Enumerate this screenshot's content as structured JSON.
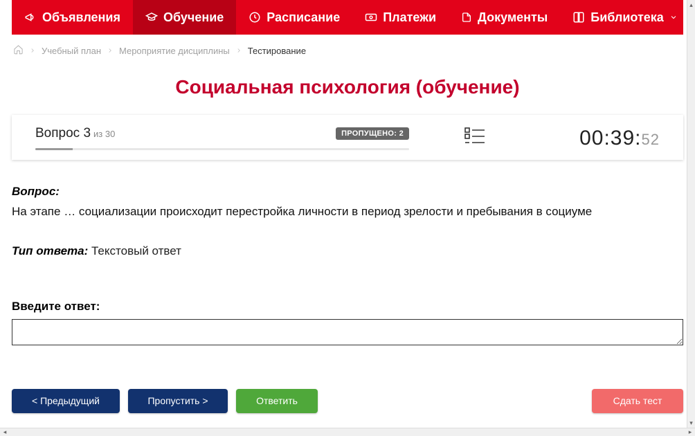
{
  "nav": {
    "items": [
      {
        "label": "Объявления",
        "icon": "megaphone-icon",
        "active": false
      },
      {
        "label": "Обучение",
        "icon": "grad-cap-icon",
        "active": true
      },
      {
        "label": "Расписание",
        "icon": "clock-icon",
        "active": false
      },
      {
        "label": "Платежи",
        "icon": "payment-icon",
        "active": false
      },
      {
        "label": "Документы",
        "icon": "document-icon",
        "active": false
      },
      {
        "label": "Библиотека",
        "icon": "book-icon",
        "active": false,
        "chevron": true
      }
    ]
  },
  "breadcrumb": {
    "items": [
      {
        "label": "Учебный план"
      },
      {
        "label": "Мероприятие дисциплины"
      },
      {
        "label": "Тестирование",
        "current": true
      }
    ]
  },
  "title": "Социальная психология (обучение)",
  "status": {
    "question_word": "Вопрос",
    "question_number": "3",
    "of_word": "из",
    "total": "30",
    "skipped_label": "ПРОПУЩЕНО:",
    "skipped_count": "2",
    "progress_percent": 10,
    "timer_mmss": "00:39:",
    "timer_secs": "52"
  },
  "question": {
    "q_label": "Вопрос:",
    "q_text": "На этапе … социализации происходит перестройка личности в период зрелости и пребывания в социуме",
    "type_label": "Тип ответа:",
    "type_value": "Текстовый ответ",
    "answer_label": "Введите ответ:",
    "answer_value": ""
  },
  "buttons": {
    "prev": "< Предыдущий",
    "skip": "Пропустить >",
    "answer": "Ответить",
    "submit": "Сдать тест"
  },
  "colors": {
    "brand_red": "#e2021a",
    "brand_red_dark": "#b80115",
    "title_red": "#c3002c",
    "navy": "#12326e",
    "green": "#4fa83a",
    "submit_red": "#f26a6a"
  }
}
